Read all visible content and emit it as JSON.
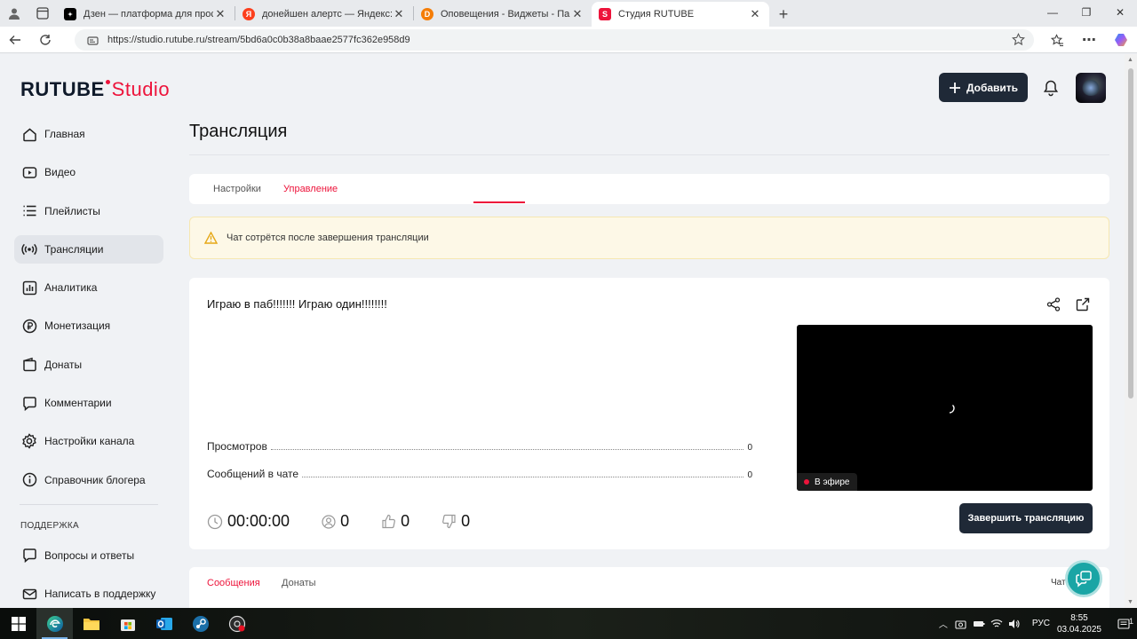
{
  "browser": {
    "tabs": [
      {
        "title": "Дзен — платформа для просмотра",
        "favicon_color": "#000000",
        "active": false
      },
      {
        "title": "донейшен алертс — Яндекс: нашлось",
        "favicon_color": "#fc3f1d",
        "active": false
      },
      {
        "title": "Оповещения - Виджеты - Панель",
        "favicon_color": "#f57d07",
        "active": false
      },
      {
        "title": "Студия RUTUBE",
        "favicon_color": "#ed143b",
        "active": true
      }
    ],
    "url": "https://studio.rutube.ru/stream/5bd6a0c0b38a8baae2577fc362e958d9"
  },
  "header": {
    "logo_main": "RUTUBE",
    "logo_studio": "Studio",
    "add_button": "Добавить"
  },
  "sidebar": {
    "items": [
      {
        "label": "Главная",
        "icon": "home-icon"
      },
      {
        "label": "Видео",
        "icon": "video-icon"
      },
      {
        "label": "Плейлисты",
        "icon": "playlist-icon"
      },
      {
        "label": "Трансляции",
        "icon": "broadcast-icon",
        "active": true
      },
      {
        "label": "Аналитика",
        "icon": "analytics-icon"
      },
      {
        "label": "Монетизация",
        "icon": "ruble-icon"
      },
      {
        "label": "Донаты",
        "icon": "wallet-icon"
      },
      {
        "label": "Комментарии",
        "icon": "comment-icon"
      },
      {
        "label": "Настройки канала",
        "icon": "gear-icon"
      },
      {
        "label": "Справочник блогера",
        "icon": "info-icon"
      }
    ],
    "support_heading": "ПОДДЕРЖКА",
    "support_items": [
      {
        "label": "Вопросы и ответы",
        "icon": "question-icon"
      },
      {
        "label": "Написать в поддержку",
        "icon": "mail-icon"
      }
    ]
  },
  "main": {
    "title": "Трансляция",
    "tabs": [
      "Настройки",
      "Управление"
    ],
    "active_tab": "Управление",
    "warning": "Чат сотрётся после завершения трансляции",
    "stream": {
      "title": "Играю в паб!!!!!!! Играю один!!!!!!!!",
      "stats": [
        {
          "label": "Просмотров",
          "value": "0"
        },
        {
          "label": "Сообщений в чате",
          "value": "0"
        }
      ],
      "live_label": "В эфире",
      "duration": "00:00:00",
      "viewers": "0",
      "likes": "0",
      "dislikes": "0",
      "end_button": "Завершить трансляцию"
    },
    "bottom_tabs": [
      "Сообщения",
      "Донаты"
    ],
    "chat_label": "Чат",
    "chat_enabled": true
  },
  "taskbar": {
    "language": "РУС",
    "time": "8:55",
    "date": "03.04.2025",
    "notifications": "1"
  },
  "colors": {
    "accent": "#ed143b",
    "dark_button": "#1f2937",
    "warning_bg": "#fdf8e7",
    "help_fab": "#1aa5a5"
  }
}
